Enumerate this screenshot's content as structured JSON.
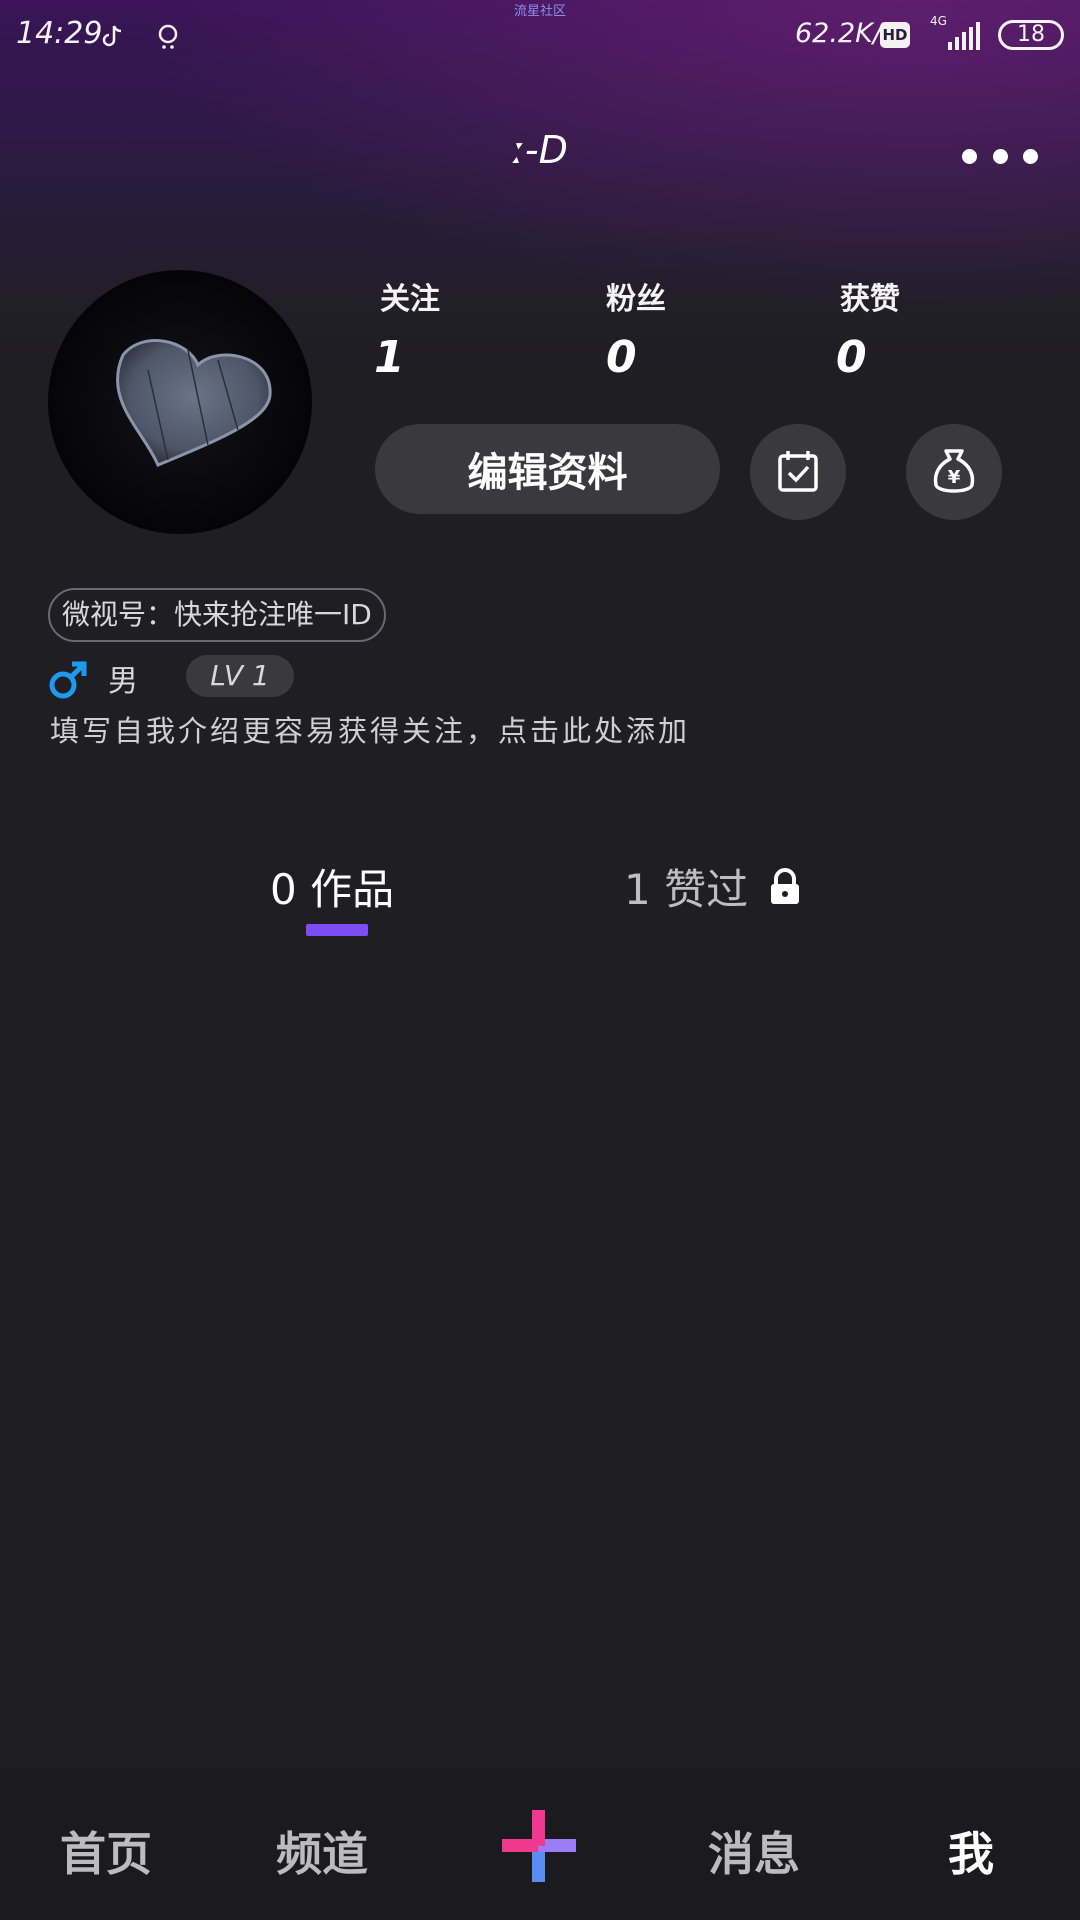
{
  "status_bar": {
    "time": "14:29",
    "center_label": "流星社区",
    "net_speed": "62.2K/s",
    "hd": "HD",
    "network": "4G",
    "battery": "18"
  },
  "header": {
    "username": "ː-D"
  },
  "profile": {
    "stats": [
      {
        "label": "关注",
        "value": "1"
      },
      {
        "label": "粉丝",
        "value": "0"
      },
      {
        "label": "获赞",
        "value": "0"
      }
    ],
    "edit_button": "编辑资料",
    "id_chip": "微视号：快来抢注唯一ID",
    "gender": "男",
    "level": "LV 1",
    "bio_placeholder": "填写自我介绍更容易获得关注，点击此处添加"
  },
  "tabs": [
    {
      "label": "0 作品",
      "active": true
    },
    {
      "label": "1 赞过",
      "active": false
    }
  ],
  "bottom_nav": [
    {
      "label": "首页",
      "active": false
    },
    {
      "label": "频道",
      "active": false
    },
    {
      "label": "消息",
      "active": false
    },
    {
      "label": "我",
      "active": true
    }
  ],
  "colors": {
    "background": "#1f1e23",
    "tab_indicator": "#7b4df2",
    "gender_icon": "#1e9bf0",
    "add_pink": "#f0388f",
    "add_blue": "#5a8cf5"
  },
  "icons": [
    "tiktok-icon",
    "weather-icon",
    "signal-icon",
    "more-icon",
    "calendar-check-icon",
    "money-bag-icon",
    "male-icon",
    "lock-icon",
    "add-icon"
  ]
}
